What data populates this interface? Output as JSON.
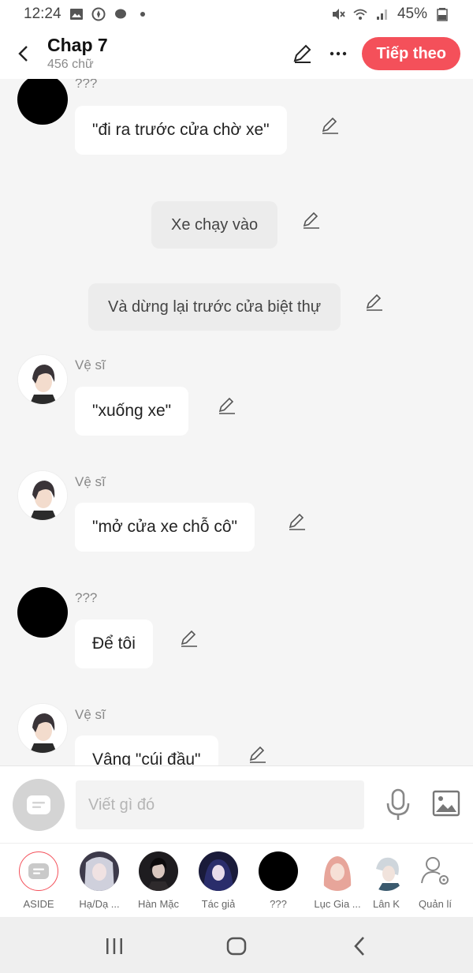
{
  "status_bar": {
    "time": "12:24",
    "battery": "45%"
  },
  "header": {
    "back_icon": "chevron-left-icon",
    "title": "Chap 7",
    "subtitle": "456 chữ",
    "next_label": "Tiếp theo",
    "accent_color": "#f4505a"
  },
  "messages": [
    {
      "speaker": "???",
      "text": "\"đi ra trước cửa chờ xe\""
    },
    {
      "narration": "Xe chạy vào"
    },
    {
      "narration": "Và dừng lại trước cửa biệt thự"
    },
    {
      "speaker": "Vệ sĩ",
      "text": "\"xuống xe\""
    },
    {
      "speaker": "Vệ sĩ",
      "text": "\"mở cửa xe chỗ cô\""
    },
    {
      "speaker": "???",
      "text": "Để tôi"
    },
    {
      "speaker": "Vệ sĩ",
      "text": "Vâng \"cúi đầu\""
    }
  ],
  "input": {
    "placeholder": "Viết gì đó"
  },
  "characters": [
    {
      "label": "ASIDE"
    },
    {
      "label": "Hạ/Dạ ..."
    },
    {
      "label": "Hàn Mặc"
    },
    {
      "label": "Tác giả"
    },
    {
      "label": "???"
    },
    {
      "label": "Lục Gia ..."
    },
    {
      "label": "Lân K"
    },
    {
      "label": "Quản lí"
    }
  ]
}
